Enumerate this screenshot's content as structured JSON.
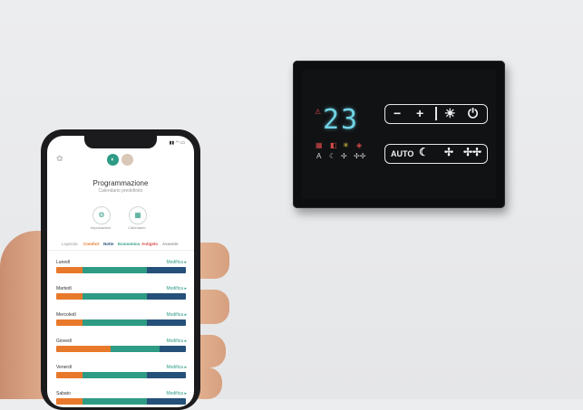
{
  "thermostat": {
    "temperature": "23",
    "buttons": {
      "minus": "−",
      "plus": "+",
      "sun": "☀",
      "power": "⏻",
      "auto": "AUTO",
      "moon": "☾",
      "fan_low": "✢",
      "fan_high": "✢✢"
    },
    "colors": {
      "display": "#6fd3e4",
      "body": "#0d0e10"
    }
  },
  "app": {
    "title": "Programmazione",
    "subtitle": "Calendario predefinito",
    "actions": [
      {
        "label": "Impostazioni",
        "icon": "gear-icon"
      },
      {
        "label": "Calendario",
        "icon": "calendar-icon"
      }
    ],
    "legend": [
      {
        "label": "Legenda",
        "color": "#999999"
      },
      {
        "label": "Comfort",
        "color": "#e8792b"
      },
      {
        "label": "Notte",
        "color": "#25507a"
      },
      {
        "label": "Economico",
        "color": "#2e9b85"
      },
      {
        "label": "Antigelo",
        "color": "#d84a4a"
      },
      {
        "label": "Assente",
        "color": "#999999"
      }
    ],
    "edit_label": "Modifica ▸",
    "days": [
      {
        "name": "Lunedì",
        "segments": [
          {
            "mode": "comfort",
            "share": 0.2
          },
          {
            "mode": "eco",
            "share": 0.5
          },
          {
            "mode": "comfort",
            "share": 0.0
          },
          {
            "mode": "night",
            "share": 0.3
          }
        ]
      },
      {
        "name": "Martedì",
        "segments": [
          {
            "mode": "comfort",
            "share": 0.2
          },
          {
            "mode": "eco",
            "share": 0.5
          },
          {
            "mode": "night",
            "share": 0.3
          }
        ]
      },
      {
        "name": "Mercoledì",
        "segments": [
          {
            "mode": "comfort",
            "share": 0.2
          },
          {
            "mode": "eco",
            "share": 0.5
          },
          {
            "mode": "night",
            "share": 0.3
          }
        ]
      },
      {
        "name": "Giovedì",
        "segments": [
          {
            "mode": "comfort",
            "share": 0.42
          },
          {
            "mode": "eco",
            "share": 0.38
          },
          {
            "mode": "night",
            "share": 0.2
          }
        ]
      },
      {
        "name": "Venerdì",
        "segments": [
          {
            "mode": "comfort",
            "share": 0.2
          },
          {
            "mode": "eco",
            "share": 0.5
          },
          {
            "mode": "night",
            "share": 0.3
          }
        ]
      },
      {
        "name": "Sabato",
        "segments": [
          {
            "mode": "comfort",
            "share": 0.2
          },
          {
            "mode": "eco",
            "share": 0.5
          },
          {
            "mode": "night",
            "share": 0.3
          }
        ]
      }
    ],
    "mode_colors": {
      "comfort": "#e8792b",
      "eco": "#2e9b85",
      "night": "#25507a"
    }
  }
}
